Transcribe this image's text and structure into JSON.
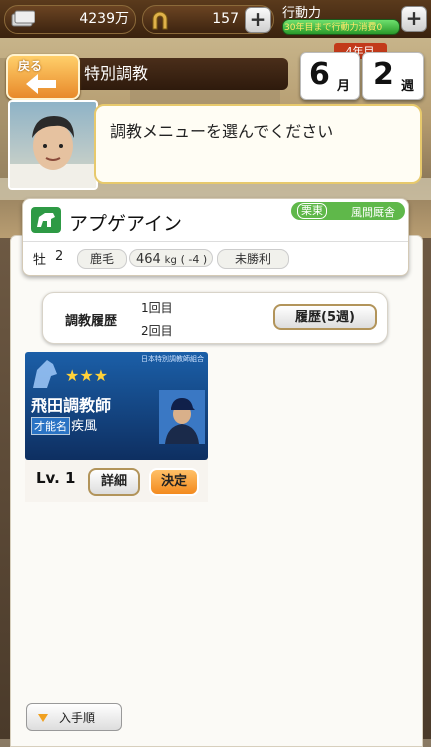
{
  "status_bar": {
    "money": "4239万",
    "horseshoe_count": "157",
    "action_label": "行動力",
    "action_note": "30年目まで行動力消費0"
  },
  "header": {
    "back_label": "戻る",
    "title": "特別調教",
    "year": "4年目",
    "month": "6",
    "month_unit": "月",
    "week": "2",
    "week_unit": "週"
  },
  "dialog": {
    "message": "調教メニューを選んでください"
  },
  "horse": {
    "name": "アプゲアイン",
    "region": "栗東",
    "stable": "風間厩舎",
    "sex": "牡",
    "age": "2",
    "coat": "鹿毛",
    "weight": "464",
    "weight_unit": "kg",
    "weight_change": "( -4 )",
    "record": "未勝利"
  },
  "history": {
    "label": "調教履歴",
    "first": "1回目",
    "second": "2回目",
    "button": "履歴(5週)"
  },
  "trainer_card": {
    "badge": "日本特別調教師組合",
    "stars": "★★★",
    "name": "飛田調教師",
    "talent_label": "才能名",
    "talent": "疾風",
    "level": "Lv. 1",
    "detail_button": "詳細",
    "decide_button": "決定"
  },
  "sort": {
    "label": "入手順"
  },
  "colors": {
    "accent_orange": "#f38a1e",
    "header_brown": "#3a220e",
    "horse_green": "#2e9a45",
    "card_blue": "#1b5fa8"
  }
}
